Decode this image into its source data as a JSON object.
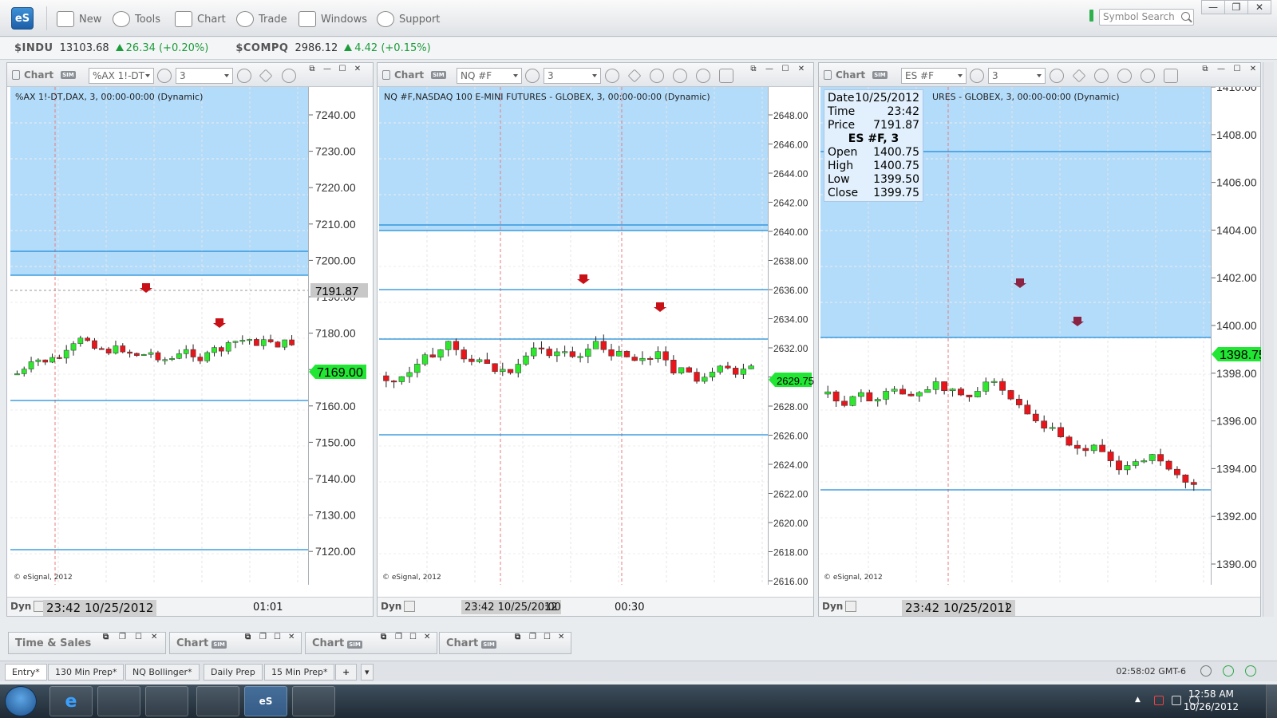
{
  "app": {
    "logo": "eS",
    "menu": [
      {
        "label": "New",
        "icon": "new-chart-icon"
      },
      {
        "label": "Tools",
        "icon": "tools-icon"
      },
      {
        "label": "Chart",
        "icon": "chart-icon"
      },
      {
        "label": "Trade",
        "icon": "trade-icon"
      },
      {
        "label": "Windows",
        "icon": "windows-icon"
      },
      {
        "label": "Support",
        "icon": "help-icon"
      }
    ],
    "symbol_search_placeholder": "Symbol Search",
    "window_controls": [
      "—",
      "❐",
      "✕"
    ]
  },
  "ticker": [
    {
      "symbol": "$INDU",
      "last": "13103.68",
      "change": "26.34 (+0.20%)"
    },
    {
      "symbol": "$COMPQ",
      "last": "2986.12",
      "change": "4.42 (+0.15%)"
    }
  ],
  "charts": [
    {
      "tab": "Chart",
      "symbol_field": "%AX 1!-DT",
      "interval_field": "3",
      "title": "%AX 1!-DT,DAX, 3, 00:00-00:00 (Dynamic)",
      "copyright": "© eSignal, 2012",
      "dyn": "Dyn",
      "timestamp": "23:42 10/25/2012",
      "time_labels": [
        "01:01"
      ],
      "price_labels": [
        "7240.00",
        "7230.00",
        "7220.00",
        "7210.00",
        "7200.00",
        "7190.00",
        "7180.00",
        "7170.00",
        "7160.00",
        "7150.00",
        "7140.00",
        "7130.00",
        "7120.00"
      ],
      "cursor_price": "7191.87",
      "last_price": "7169.00",
      "colors": {
        "up": "#2ee82e",
        "down": "#e8151b",
        "zone": "#b3dcfb",
        "line": "#1b8ad6"
      }
    },
    {
      "tab": "Chart",
      "symbol_field": "NQ #F",
      "interval_field": "3",
      "title": "NQ #F,NASDAQ 100 E-MINI FUTURES - GLOBEX, 3, 00:00-00:00 (Dynamic)",
      "copyright": "© eSignal, 2012",
      "dyn": "Dyn",
      "timestamp": "23:42 10/25/2012",
      "time_labels": [
        ":00",
        "00:30"
      ],
      "price_labels": [
        "2648.00",
        "2646.00",
        "2644.00",
        "2642.00",
        "2640.00",
        "2638.00",
        "2636.00",
        "2634.00",
        "2632.00",
        "2630.00",
        "2628.00",
        "2626.00",
        "2624.00",
        "2622.00",
        "2620.00",
        "2618.00",
        "2616.00"
      ],
      "last_price": "2629.75",
      "colors": {
        "up": "#2ee82e",
        "down": "#e8151b",
        "zone": "#b3dcfb",
        "line": "#1b8ad6"
      }
    },
    {
      "tab": "Chart",
      "symbol_field": "ES #F",
      "interval_field": "3",
      "title": "URES - GLOBEX, 3, 00:00-00:00 (Dynamic)",
      "copyright": "© eSignal, 2012",
      "dyn": "Dyn",
      "timestamp": "23:42 10/25/2012",
      "time_labels": [
        ")"
      ],
      "price_labels": [
        "1410.00",
        "1408.00",
        "1406.00",
        "1404.00",
        "1402.00",
        "1400.00",
        "1398.00",
        "1396.00",
        "1394.00",
        "1392.00",
        "1390.00"
      ],
      "last_price": "1398.75",
      "data_window": {
        "date_label": "Date",
        "date": "10/25/2012",
        "time_label": "Time",
        "time": "23:42",
        "price_label": "Price",
        "price": "7191.87",
        "header": "ES #F, 3",
        "open_label": "Open",
        "open": "1400.75",
        "high_label": "High",
        "high": "1400.75",
        "low_label": "Low",
        "low": "1399.50",
        "close_label": "Close",
        "close": "1399.75"
      },
      "colors": {
        "up": "#2ee82e",
        "down": "#e8151b",
        "zone": "#b3dcfb",
        "line": "#1b8ad6"
      }
    }
  ],
  "bottom_windows": [
    {
      "label": "Time & Sales"
    },
    {
      "label": "Chart"
    },
    {
      "label": "Chart"
    },
    {
      "label": "Chart"
    }
  ],
  "page_tabs": [
    "Entry*",
    "130 Min Prep*",
    "NQ Bollinger*",
    "Daily Prep",
    "15 Min Prep*"
  ],
  "add_tab": "+",
  "status_time": "02:58:02 GMT-6",
  "taskbar": {
    "clock_time": "12:58 AM",
    "clock_date": "10/26/2012",
    "apps": [
      "IE",
      "Explorer",
      "Media",
      "Network",
      "eS",
      "Other"
    ]
  }
}
